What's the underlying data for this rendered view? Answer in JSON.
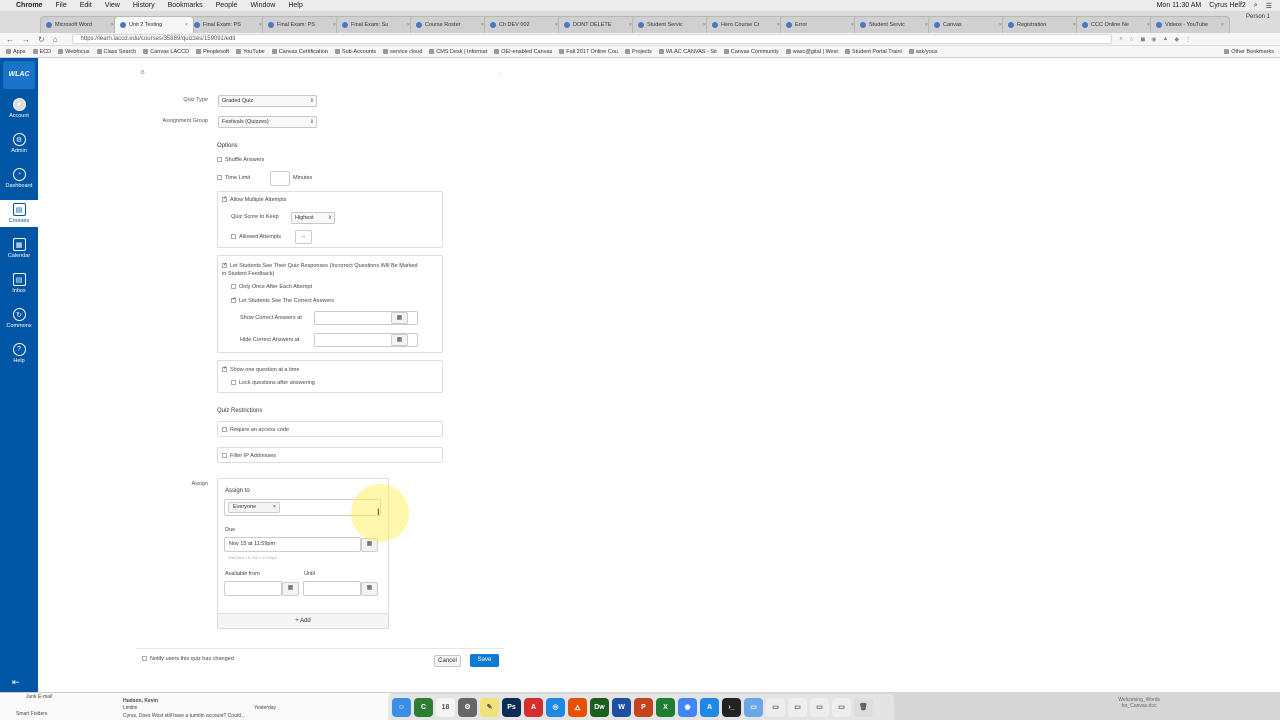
{
  "menubar": {
    "app": "Chrome",
    "items": [
      "File",
      "Edit",
      "View",
      "History",
      "Bookmarks",
      "People",
      "Window",
      "Help"
    ],
    "clock": "Mon 11:30 AM",
    "user": "Cyrus Helf2"
  },
  "tabs": [
    {
      "label": "Microsoft Word"
    },
    {
      "label": "Unit 2 Testing",
      "active": true
    },
    {
      "label": "Final Exam: PS"
    },
    {
      "label": "Final Exam: PS"
    },
    {
      "label": "Final Exam: Su"
    },
    {
      "label": "Course Roster"
    },
    {
      "label": "Ch DEV 002"
    },
    {
      "label": "DONT DELETE"
    },
    {
      "label": "Student Servic"
    },
    {
      "label": "Hero Course Cr"
    },
    {
      "label": "Error"
    },
    {
      "label": "Student Servic"
    },
    {
      "label": "Canvas"
    },
    {
      "label": "Registration"
    },
    {
      "label": "CCC Online Ne"
    },
    {
      "label": "Videos - YouTube"
    }
  ],
  "person": "Person 1",
  "address": {
    "url": "https://learn.laccd.edu/courses/35889/quizzes/159091/edit"
  },
  "bookmarks": {
    "items": [
      "Apps",
      "ECD",
      "Webfocus",
      "Class Search",
      "Canvas LACCD",
      "Peoplesoft",
      "YouTube",
      "Canvas Certification",
      "Sub-Accounts",
      "service cloud",
      "CMS Desk | Informat",
      "OEI-enabled Canvas",
      "Fall 2017 Online Cou",
      "Projects",
      "WLAC CANVAS - Sit",
      "Canvas Community",
      "wasc@gital | West",
      "Student Portal Traini",
      "ask/yous"
    ],
    "other": "Other Bookmarks"
  },
  "sidebar": {
    "logo": "WLAC",
    "items": [
      {
        "label": "Account",
        "icon": "user-avatar"
      },
      {
        "label": "Admin",
        "icon": "shield-icon"
      },
      {
        "label": "Dashboard",
        "icon": "dashboard-icon"
      },
      {
        "label": "Courses",
        "icon": "book-icon",
        "active": true
      },
      {
        "label": "Calendar",
        "icon": "calendar-icon"
      },
      {
        "label": "Inbox",
        "icon": "inbox-icon"
      },
      {
        "label": "Commons",
        "icon": "commons-icon"
      },
      {
        "label": "Help",
        "icon": "help-icon"
      }
    ]
  },
  "form": {
    "quiz_type_label": "Quiz Type",
    "quiz_type_value": "Graded Quiz",
    "assignment_group_label": "Assignment Group",
    "assignment_group_value": "Festivals (Quizzes)",
    "options_heading": "Options",
    "shuffle_answers": "Shuffle Answers",
    "time_limit": "Time Limit",
    "minutes": "Minutes",
    "allow_multiple": "Allow Multiple Attempts",
    "quiz_score_label": "Quiz Score to Keep",
    "quiz_score_value": "Highest",
    "allowed_attempts": "Allowed Attempts",
    "allowed_attempts_value": "--",
    "let_students_see": "Let Students See Their Quiz Responses (Incorrect Questions Will Be Marked in Student Feedback)",
    "only_once": "Only Once After Each Attempt",
    "see_correct": "Let Students See The Correct Answers",
    "show_correct_at": "Show Correct Answers at",
    "hide_correct_at": "Hide Correct Answers at",
    "one_question": "Show one question at a time",
    "lock_questions": "Lock questions after answering",
    "restrictions_heading": "Quiz Restrictions",
    "require_code": "Require an access code",
    "filter_ip": "Filter IP Addresses",
    "assign_label": "Assign",
    "assign_to": "Assign to",
    "assignee": "Everyone",
    "due_label": "Due",
    "due_value": "Nov 15 at 11:59pm",
    "due_hint": "Wed Nov 15, 2017 11:59pm",
    "available_from": "Available from",
    "until": "Until",
    "add": "+ Add",
    "notify": "Notify users this quiz has changed",
    "cancel": "Cancel",
    "save": "Save"
  },
  "mail": {
    "folders": [
      "Junk E-mail",
      "Smart Folders"
    ],
    "sender": "Hudson, Kevin",
    "subject": "Cyrus, Does West still have a turnitin account? Could...",
    "date": "Yesterday",
    "line2": "Limitin"
  },
  "desktop_note": {
    "line1": "Welcoming_Words",
    "line2": "for_Canvas.doc"
  },
  "dock_items": [
    "Finder",
    "Camtasia",
    "Calendar",
    "Preferences",
    "Notes",
    "Photoshop",
    "Acrobat",
    "Safari",
    "Firefox",
    "Dreamweaver",
    "Word",
    "PowerPoint",
    "Excel",
    "Chrome",
    "App Store",
    "Terminal",
    "Folder",
    "Doc",
    "Doc",
    "Doc",
    "Doc",
    "Trash"
  ]
}
